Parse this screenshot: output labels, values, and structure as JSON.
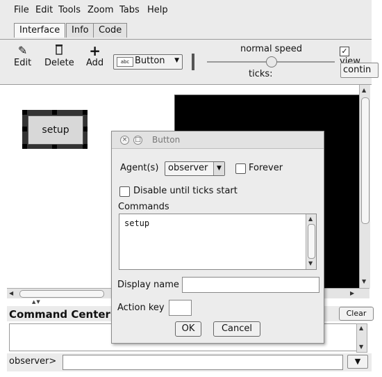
{
  "menubar": {
    "items": [
      "File",
      "Edit",
      "Tools",
      "Zoom",
      "Tabs",
      "Help"
    ]
  },
  "tabs": [
    {
      "label": "Interface"
    },
    {
      "label": "Info"
    },
    {
      "label": "Code"
    }
  ],
  "toolbar": {
    "edit_label": "Edit",
    "delete_label": "Delete",
    "add_label": "Add",
    "widget_type": "Button",
    "widget_type_icon": "abc",
    "speed_label": "normal speed",
    "speed_fraction": 0.5,
    "ticks_label": "ticks:",
    "view_updates_label": "view",
    "view_updates_checked": true,
    "update_mode": "contin"
  },
  "interface": {
    "setup_button_label": "setup"
  },
  "command_center": {
    "title": "Command Center",
    "clear_label": "Clear",
    "prompt": "observer>",
    "input_value": ""
  },
  "dialog": {
    "title": "Button",
    "agents_label": "Agent(s)",
    "agents_value": "observer",
    "forever_label": "Forever",
    "forever_checked": false,
    "disable_label": "Disable until ticks start",
    "disable_checked": false,
    "commands_label": "Commands",
    "commands_value": "setup",
    "display_name_label": "Display name",
    "display_name_value": "",
    "action_key_label": "Action key",
    "action_key_value": "",
    "ok_label": "OK",
    "cancel_label": "Cancel"
  },
  "icons": {
    "edit": "pencil-icon",
    "delete": "trash-icon",
    "add": "plus-icon",
    "close": "close-icon",
    "minimize": "minimize-icon",
    "dropdown": "chevron-down-icon"
  }
}
